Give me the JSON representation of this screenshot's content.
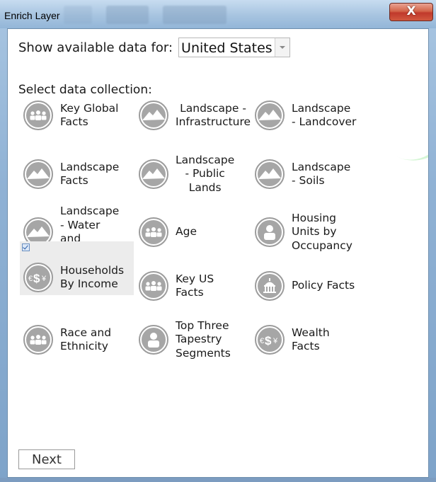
{
  "window": {
    "title": "Enrich Layer",
    "close_glyph": "X"
  },
  "form": {
    "show_label": "Show available data for:",
    "country_value": "United States",
    "select_label": "Select data collection:",
    "next_label": "Next"
  },
  "collections": [
    {
      "label": "Key Global\nFacts",
      "icon": "people-icon",
      "selected": false
    },
    {
      "label": "Landscape -\nInfrastructure",
      "icon": "landscape-icon",
      "selected": false
    },
    {
      "label": "Landscape\n- Landcover",
      "icon": "landscape-icon",
      "selected": false
    },
    {
      "label": "Landscape\nFacts",
      "icon": "landscape-icon",
      "selected": false
    },
    {
      "label": "Landscape\n- Public\nLands",
      "icon": "landscape-icon",
      "selected": false
    },
    {
      "label": "Landscape\n- Soils",
      "icon": "landscape-icon",
      "selected": false
    },
    {
      "label": "Landscape\n- Water\nand\nWetlands",
      "icon": "landscape-icon",
      "selected": false
    },
    {
      "label": "Age",
      "icon": "people-icon",
      "selected": false
    },
    {
      "label": "Housing\nUnits by\nOccupancy",
      "icon": "person-icon",
      "selected": false
    },
    {
      "label": "Households\nBy Income",
      "icon": "currency-icon",
      "selected": true
    },
    {
      "label": "Key US\nFacts",
      "icon": "people-icon",
      "selected": false
    },
    {
      "label": "Policy Facts",
      "icon": "capitol-icon",
      "selected": false
    },
    {
      "label": "Race and\nEthnicity",
      "icon": "people-icon",
      "selected": false
    },
    {
      "label": "Top Three\nTapestry\nSegments",
      "icon": "person-icon",
      "selected": false
    },
    {
      "label": "Wealth\nFacts",
      "icon": "currency-icon",
      "selected": false
    }
  ]
}
